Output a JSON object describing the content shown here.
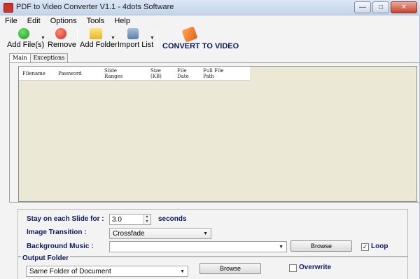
{
  "window": {
    "title": "PDF to Video Converter V1.1 - 4dots Software",
    "buttons": {
      "minimize": "—",
      "maximize": "□",
      "close": "✕"
    }
  },
  "menu": [
    "File",
    "Edit",
    "Options",
    "Tools",
    "Help"
  ],
  "toolbar": {
    "add_files": "Add File(s)",
    "remove": "Remove",
    "add_folder": "Add Folder",
    "import_list": "Import List",
    "convert": "CONVERT TO VIDEO"
  },
  "tabs": [
    "Main",
    "Exceptions"
  ],
  "grid": {
    "columns": [
      "Filename",
      "Password",
      "Slide\nRanges",
      "Size\n(KB)",
      "File\nDate",
      "Full File\nPath"
    ],
    "rows": []
  },
  "settings": {
    "stay_label": "Stay on each Slide for :",
    "stay_value": "3.0",
    "stay_unit": "seconds",
    "transition_label": "Image Transition :",
    "transition_value": "Crossfade",
    "music_label": "Background Music :",
    "music_value": "",
    "browse_label": "Browse",
    "loop_label": "Loop",
    "loop_checked": true
  },
  "output": {
    "title": "Output Folder",
    "folder_value": "Same Folder of Document",
    "browse_label": "Browse",
    "overwrite_label": "Overwrite",
    "overwrite_checked": false
  },
  "colors": {
    "label_blue": "#0b1c5f",
    "grid_bg": "#ebe8d6"
  }
}
